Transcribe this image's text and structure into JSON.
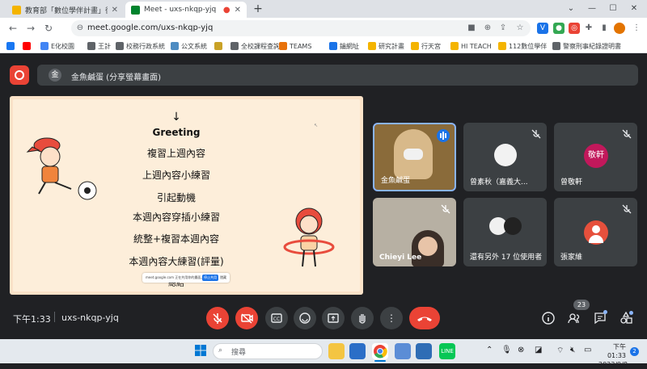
{
  "browser": {
    "tabs": [
      {
        "title": "教育部「數位學伴計畫」後臺管",
        "favicon_color": "#f4b400",
        "active": false
      },
      {
        "title": "Meet - uxs-nkqp-yjq",
        "favicon_color": "#00832d",
        "active": true
      }
    ],
    "new_tab_label": "+",
    "window_controls": [
      "⌄",
      "—",
      "☐",
      "✕"
    ],
    "url": "meet.google.com/uxs-nkqp-yjq"
  },
  "bookmarks": [
    {
      "label": "",
      "icon_color": "#1877f2"
    },
    {
      "label": "",
      "icon_color": "#ff0000"
    },
    {
      "label": "E化校園",
      "icon_color": "#4285f4"
    },
    {
      "label": "王計",
      "icon_color": "#5f6368"
    },
    {
      "label": "校務行政系統",
      "icon_color": "#5f6368"
    },
    {
      "label": "公文系統",
      "icon_color": "#4e8cc2"
    },
    {
      "label": "",
      "icon_color": "#c9a227"
    },
    {
      "label": "全校課程查詢",
      "icon_color": "#5f6368"
    },
    {
      "label": "TEAMS",
      "icon_color": "#e8710a"
    },
    {
      "label": "鑰網址",
      "icon_color": "#1a73e8"
    },
    {
      "label": "研究計畫",
      "icon_color": "#f4b400"
    },
    {
      "label": "行天宮",
      "icon_color": "#f4b400"
    },
    {
      "label": "HI TEACH",
      "icon_color": "#f4b400"
    },
    {
      "label": "112數位學伴",
      "icon_color": "#f4b400"
    },
    {
      "label": "警察刑事紀錄證明書",
      "icon_color": "#5f6368"
    }
  ],
  "meet": {
    "presenter_label": "金魚鹹蛋 (分享螢幕畫面)",
    "presenter_avatar": "金",
    "slide": {
      "arrow": "↓",
      "lines": [
        "Greeting",
        "複習上週內容",
        "上週內容小練習",
        "引起動機",
        "本週內容穿插小練習",
        "統整+複習本週內容",
        "本週內容大練習(評量)"
      ],
      "cut_line": "總結",
      "share_bar_text": "meet.google.com 正在共用你的畫面。",
      "share_bar_stop": "停止共用",
      "share_bar_hide": "隱藏"
    },
    "tiles": [
      {
        "name": "金魚鹹蛋",
        "speaking": true,
        "avatar_text": ""
      },
      {
        "name": "曾素秋（嘉義大...",
        "speaking": false,
        "avatar_text": ""
      },
      {
        "name": "曾敬軒",
        "speaking": false,
        "avatar_text": "敬軒",
        "avatar_color": "#c2185b"
      },
      {
        "name": "Chieyi Lee",
        "speaking": false,
        "avatar_text": ""
      },
      {
        "name": "還有另外 17 位使用者",
        "speaking": false,
        "avatar_text": ""
      },
      {
        "name": "張家維",
        "speaking": false,
        "avatar_text": "",
        "avatar_color": "#e6503c"
      }
    ],
    "time": "下午1:33",
    "meeting_code": "uxs-nkqp-yjq",
    "people_count": "23"
  },
  "taskbar": {
    "search_label": "搜尋",
    "tray_time": "下午 01:33",
    "tray_date": "2023/9/8",
    "notification_count": "2"
  }
}
